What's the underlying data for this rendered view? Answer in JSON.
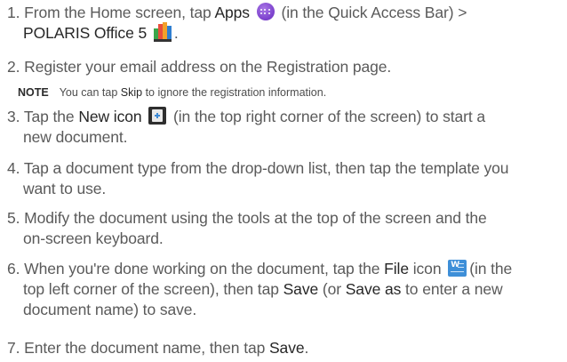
{
  "steps": [
    {
      "num": "1.",
      "t1": "From the Home screen, tap ",
      "b1": "Apps",
      "t2": " (in the Quick Access Bar) >",
      "b2": "POLARIS Office 5",
      "t3": "."
    },
    {
      "num": "2.",
      "t1": "Register your email address on the Registration page."
    },
    {
      "num": "3.",
      "t1": "Tap the ",
      "b1": "New icon",
      "t2": " (in the top right corner of the screen) to start a",
      "t3": "new document."
    },
    {
      "num": "4.",
      "t1": "Tap a document type from the drop-down list, then tap the template you",
      "t2": "want to use."
    },
    {
      "num": "5.",
      "t1": "Modify the document using the tools at the top of the screen and the",
      "t2": "on-screen keyboard."
    },
    {
      "num": "6.",
      "t1": "When you're done working on the document, tap the ",
      "b1": "File",
      "t2": " icon ",
      "t3": "(in the",
      "t4": "top left corner of the screen), then tap ",
      "b2": "Save",
      "t5": " (or ",
      "b3": "Save as",
      "t6": " to enter a new",
      "t7": "document name) to save."
    },
    {
      "num": "7.",
      "t1": "Enter the document name, then tap ",
      "b1": "Save",
      "t2": "."
    }
  ],
  "note": {
    "label": "NOTE",
    "t1": "You can tap ",
    "b1": "Skip",
    "t2": " to ignore the registration information."
  },
  "icons": {
    "apps": "apps-icon",
    "polaris": "polaris-office-icon",
    "new": "new-document-icon",
    "file": "file-icon"
  },
  "colors": {
    "text": "#5a5a5a",
    "emphasis": "#262626",
    "apps_purple": "#7a3fcc",
    "file_blue": "#3e8fd8"
  }
}
